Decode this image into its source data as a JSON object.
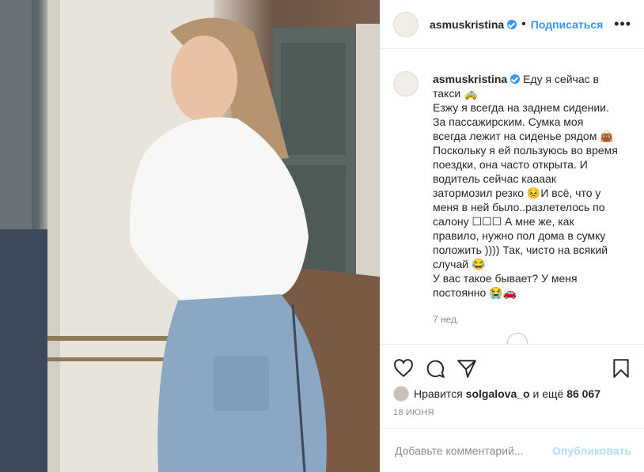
{
  "post": {
    "username": "asmuskristina",
    "follow_label": "Подписаться",
    "more_label": "•••"
  },
  "caption": {
    "username": "asmuskristina",
    "text": "Еду я сейчас в такси 🚕\nЕзжу я всегда на заднем сидении. За пассажирским. Сумка моя всегда лежит на сиденье рядом 👜 Поскольку я ей пользуюсь во время поездки, она часто открыта. И водитель сейчас каааак затормозил резко 😣И всё, что у меня в ней было..разлетелось по салону ☐☐☐ А мне же, как правило, нужно пол дома в сумку положить )))) Так, чисто на всякий случай 😂\nУ вас такое бывает? У меня постоянно 😭🚗",
    "age": "7 нед."
  },
  "likes": {
    "prefix": "Нравится",
    "user": "solgalova_o",
    "middle": "и ещё",
    "count": "86 067"
  },
  "date": "18 ИЮНЯ",
  "comment": {
    "placeholder": "Добавьте комментарий...",
    "post_label": "Опубликовать"
  },
  "icons": {
    "like": "heart-icon",
    "comment": "comment-icon",
    "share": "share-icon",
    "save": "bookmark-icon"
  },
  "colors": {
    "link": "#3897f0",
    "muted": "#8e8e8e",
    "post_disabled": "#b2dffc"
  }
}
